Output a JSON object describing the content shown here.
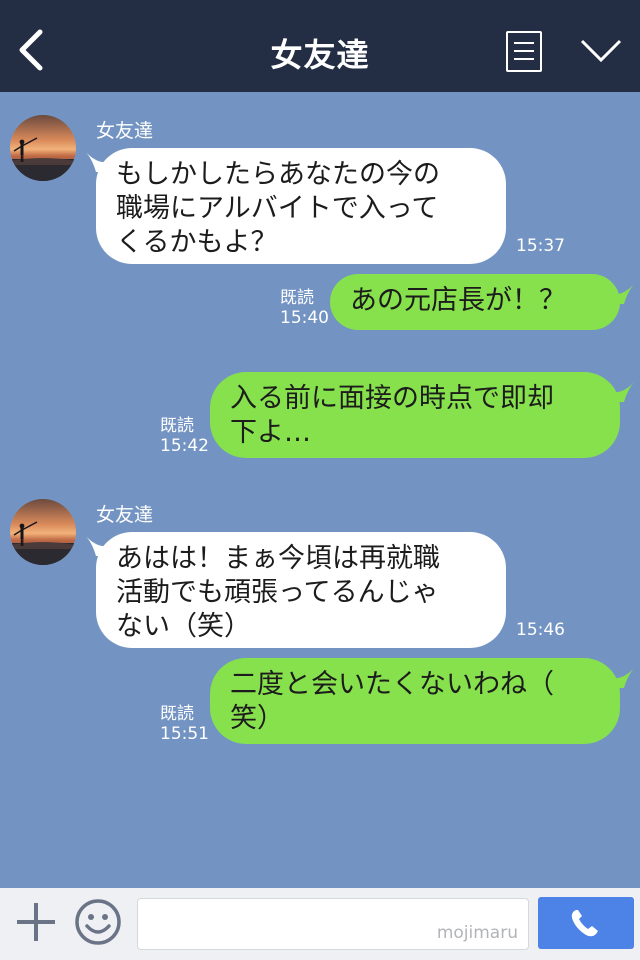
{
  "header": {
    "title": "女友達",
    "back_icon": "chevron-left-icon",
    "menu_icon": "note-menu-icon",
    "collapse_icon": "chevron-down-icon"
  },
  "messages": [
    {
      "side": "in",
      "sender": "女友達",
      "text": "もしかしたらあなたの今の\n職場にアルバイトで入って\nくるかもよ？",
      "time": "15:37"
    },
    {
      "side": "out",
      "read": "既読",
      "text": "あの元店長が！？",
      "time": "15:40"
    },
    {
      "side": "out",
      "read": "既読",
      "text": "入る前に面接の時点で即却\n下よ…",
      "time": "15:42"
    },
    {
      "side": "in",
      "sender": "女友達",
      "text": "あはは！まぁ今頃は再就職\n活動でも頑張ってるんじゃ\nない（笑）",
      "time": "15:46"
    },
    {
      "side": "out",
      "read": "既読",
      "text": "二度と会いたくないわね（\n笑）",
      "time": "15:51"
    }
  ],
  "footer": {
    "plus_icon": "plus-icon",
    "sticker_icon": "smiley-icon",
    "input_value": "",
    "watermark": "mojimaru",
    "call_icon": "phone-icon"
  },
  "colors": {
    "header_bg": "#232d43",
    "chat_bg": "#7394c3",
    "incoming_bubble": "#ffffff",
    "outgoing_bubble": "#86e14d",
    "call_button": "#4d82e6"
  }
}
